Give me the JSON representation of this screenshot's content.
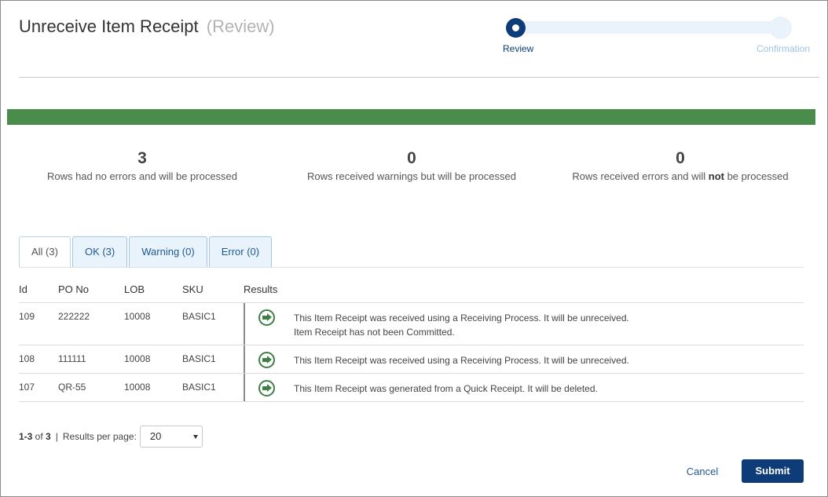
{
  "header": {
    "title": "Unreceive Item Receipt",
    "subtitle": "(Review)"
  },
  "stepper": {
    "steps": [
      "Review",
      "Confirmation"
    ],
    "active_step": "Review"
  },
  "progress_bar": {
    "fraction": 1.0,
    "color": "#498c4b"
  },
  "summary": [
    {
      "count": "3",
      "text": "Rows had no errors and will be processed"
    },
    {
      "count": "0",
      "text": "Rows received warnings but will be processed"
    },
    {
      "count": "0",
      "text_before": "Rows received errors and will ",
      "text_bold": "not",
      "text_after": " be processed"
    }
  ],
  "tabs": [
    {
      "label": "All (3)",
      "active": true
    },
    {
      "label": "OK (3)",
      "active": false
    },
    {
      "label": "Warning (0)",
      "active": false
    },
    {
      "label": "Error (0)",
      "active": false
    }
  ],
  "grid": {
    "columns": [
      "Id",
      "PO No",
      "LOB",
      "SKU",
      "Results"
    ],
    "rows": [
      {
        "id": "109",
        "po": "222222",
        "lob": "10008",
        "sku": "BASIC1",
        "icon": "arrow-circle-right-icon",
        "messages": [
          "This Item Receipt was received using a Receiving Process. It will be unreceived.",
          "Item Receipt has not been Committed."
        ]
      },
      {
        "id": "108",
        "po": "111111",
        "lob": "10008",
        "sku": "BASIC1",
        "icon": "arrow-circle-right-icon",
        "messages": [
          "This Item Receipt was received using a Receiving Process. It will be unreceived."
        ]
      },
      {
        "id": "107",
        "po": "QR-55",
        "lob": "10008",
        "sku": "BASIC1",
        "icon": "arrow-circle-right-icon",
        "messages": [
          "This Item Receipt was generated from a Quick Receipt. It will be deleted."
        ]
      }
    ]
  },
  "pager": {
    "range": "1-3",
    "of_label": " of ",
    "total": "3",
    "separator": "|",
    "per_page_label": "Results per page:",
    "per_page_value": "20"
  },
  "actions": {
    "cancel": "Cancel",
    "submit": "Submit"
  },
  "colors": {
    "primary": "#0d3c78",
    "success": "#498c4b",
    "link": "#1e5896"
  }
}
